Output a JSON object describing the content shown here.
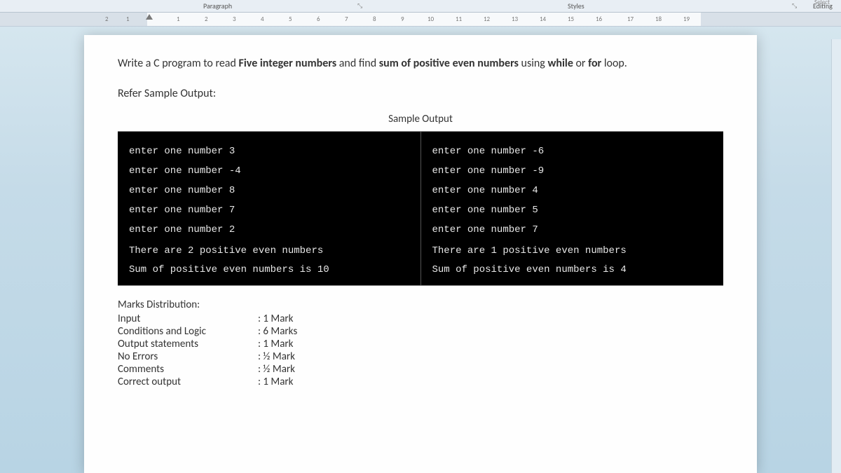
{
  "ribbon": {
    "paragraph": "Paragraph",
    "styles": "Styles",
    "editing": "Editing",
    "select": "Select",
    "launcher": "⤡"
  },
  "ruler": {
    "left_nums": [
      "2",
      "1"
    ],
    "nums": [
      "1",
      "2",
      "3",
      "4",
      "5",
      "6",
      "7",
      "8",
      "9",
      "10",
      "11",
      "12",
      "13",
      "14",
      "15",
      "16",
      "17",
      "18",
      "19"
    ]
  },
  "question": {
    "before_b1": "Write a C program to read ",
    "b1": "Five integer numbers",
    "mid1": " and find ",
    "b2": "sum of positive even numbers",
    "mid2": " using ",
    "b3": "while",
    "mid3": " or ",
    "b4": "for",
    "after": " loop."
  },
  "refer": "Refer Sample Output:",
  "sample_title": "Sample Output",
  "sample_left": {
    "l1": "enter one number 3",
    "l2": "enter one number -4",
    "l3": "enter one number 8",
    "l4": "enter one number 7",
    "l5": "enter one number 2",
    "r1": "There are 2 positive even numbers",
    "r2": "Sum of positive even numbers is 10"
  },
  "sample_right": {
    "l1": "enter one number -6",
    "l2": "enter one number -9",
    "l3": "enter one number 4",
    "l4": "enter one number 5",
    "l5": "enter one number 7",
    "r1": "There are 1 positive even numbers",
    "r2": "Sum of positive even numbers is 4"
  },
  "marks": {
    "title": "Marks Distribution:",
    "rows": [
      {
        "label": "Input",
        "val": ": 1 Mark"
      },
      {
        "label": "Conditions and Logic",
        "val": ": 6 Marks"
      },
      {
        "label": "Output statements",
        "val": ": 1 Mark"
      },
      {
        "label": "No Errors",
        "val": ": ½ Mark"
      },
      {
        "label": "Comments",
        "val": ": ½ Mark"
      },
      {
        "label": "Correct output",
        "val": ": 1 Mark"
      }
    ]
  }
}
